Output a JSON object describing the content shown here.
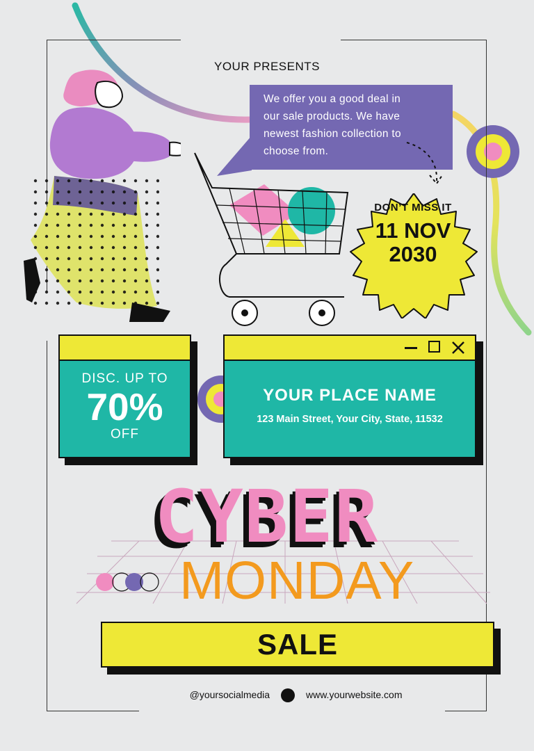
{
  "header": {
    "text": "YOUR PRESENTS"
  },
  "speech": {
    "lines": [
      "We offer you a good deal in",
      "our sale products. We have",
      "newest fashion collection to",
      "choose from."
    ]
  },
  "badge": {
    "top": "DON’T MISS IT",
    "date_line1": "11 NOV",
    "date_line2": "2030"
  },
  "discount": {
    "line1": "DISC. UP TO",
    "percent": "70%",
    "line3": "OFF"
  },
  "place": {
    "name": "YOUR PLACE NAME",
    "address": "123 Main Street, Your City, State, 11532"
  },
  "title": {
    "line1": "CYBER",
    "line2": "MONDAY"
  },
  "sale": {
    "label": "SALE"
  },
  "footer": {
    "social": "@yoursocialmedia",
    "website": "www.yourwebsite.com"
  },
  "colors": {
    "background": "#e8e9ea",
    "teal": "#1fb7a6",
    "yellow": "#eee836",
    "purple": "#7468b2",
    "pink": "#f08cc0",
    "orange": "#f39a1e"
  }
}
